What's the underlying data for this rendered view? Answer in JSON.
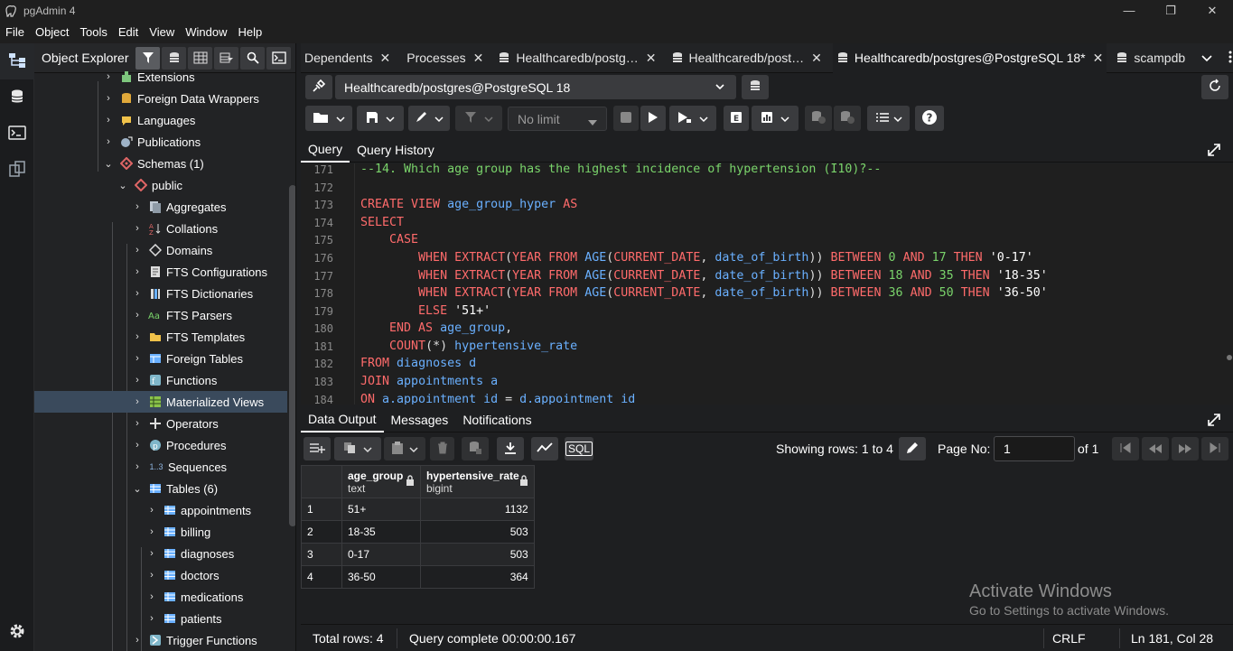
{
  "window": {
    "title": "pgAdmin 4",
    "controls": [
      "—",
      "❐",
      "✕"
    ]
  },
  "menu": [
    "File",
    "Object",
    "Tools",
    "Edit",
    "View",
    "Window",
    "Help"
  ],
  "explorer": {
    "title": "Object Explorer",
    "items": [
      {
        "label": "Extensions",
        "icon": "extensions-icon"
      },
      {
        "label": "Foreign Data Wrappers",
        "icon": "fdw-icon"
      },
      {
        "label": "Languages",
        "icon": "languages-icon"
      },
      {
        "label": "Publications",
        "icon": "publications-icon"
      },
      {
        "label": "Schemas (1)",
        "icon": "schemas-icon"
      },
      {
        "label": "public",
        "icon": "schema-icon"
      },
      {
        "label": "Aggregates",
        "icon": "aggregates-icon"
      },
      {
        "label": "Collations",
        "icon": "collations-icon"
      },
      {
        "label": "Domains",
        "icon": "domains-icon"
      },
      {
        "label": "FTS Configurations",
        "icon": "fts-config-icon"
      },
      {
        "label": "FTS Dictionaries",
        "icon": "fts-dict-icon"
      },
      {
        "label": "FTS Parsers",
        "icon": "fts-parser-icon"
      },
      {
        "label": "FTS Templates",
        "icon": "fts-template-icon"
      },
      {
        "label": "Foreign Tables",
        "icon": "foreign-table-icon"
      },
      {
        "label": "Functions",
        "icon": "functions-icon"
      },
      {
        "label": "Materialized Views",
        "icon": "matview-icon"
      },
      {
        "label": "Operators",
        "icon": "operators-icon"
      },
      {
        "label": "Procedures",
        "icon": "procedures-icon"
      },
      {
        "label": "Sequences",
        "icon": "sequences-icon"
      },
      {
        "label": "Tables (6)",
        "icon": "tables-icon"
      },
      {
        "label": "appointments",
        "icon": "table-icon"
      },
      {
        "label": "billing",
        "icon": "table-icon"
      },
      {
        "label": "diagnoses",
        "icon": "table-icon"
      },
      {
        "label": "doctors",
        "icon": "table-icon"
      },
      {
        "label": "medications",
        "icon": "table-icon"
      },
      {
        "label": "patients",
        "icon": "table-icon"
      },
      {
        "label": "Trigger Functions",
        "icon": "trigger-functions-icon"
      }
    ],
    "sequences_prefix": "1..3"
  },
  "tabs": [
    {
      "label": "Dependents"
    },
    {
      "label": "Processes"
    },
    {
      "label": "Healthcaredb/postg…"
    },
    {
      "label": "Healthcaredb/post…"
    },
    {
      "label": "Healthcaredb/postgres@PostgreSQL 18*"
    },
    {
      "label": "scampdb"
    }
  ],
  "connection": {
    "label": "Healthcaredb/postgres@PostgreSQL 18"
  },
  "toolbar": {
    "limit_label": "No limit"
  },
  "query_tabs": [
    "Query",
    "Query History"
  ],
  "editor": {
    "line_numbers": [
      "171",
      "172",
      "173",
      "174",
      "175",
      "176",
      "177",
      "178",
      "179",
      "180",
      "181",
      "182",
      "183",
      "184"
    ]
  },
  "output_tabs": [
    "Data Output",
    "Messages",
    "Notifications"
  ],
  "data_output": {
    "rows_info": "Showing rows: 1 to 4",
    "page_label": "Page No:",
    "page_value": "1",
    "of_label": "of 1",
    "sql_label": "SQL",
    "columns": [
      {
        "name": "age_group",
        "type": "text"
      },
      {
        "name": "hypertensive_rate",
        "type": "bigint"
      }
    ],
    "rows": [
      {
        "n": "1",
        "age_group": "51+",
        "rate": "1132"
      },
      {
        "n": "2",
        "age_group": "18-35",
        "rate": "503"
      },
      {
        "n": "3",
        "age_group": "0-17",
        "rate": "503"
      },
      {
        "n": "4",
        "age_group": "36-50",
        "rate": "364"
      }
    ]
  },
  "status": {
    "total_rows": "Total rows: 4",
    "query_status": "Query complete 00:00:00.167",
    "eol": "CRLF",
    "position": "Ln 181, Col 28"
  },
  "watermark": {
    "line1": "Activate Windows",
    "line2": "Go to Settings to activate Windows."
  },
  "colors": {
    "keyword": "#ff6b6b",
    "identifier": "#6ab0ff",
    "number": "#7ad46b",
    "comment": "#7ad46b",
    "selection": "#3a4a5c"
  }
}
